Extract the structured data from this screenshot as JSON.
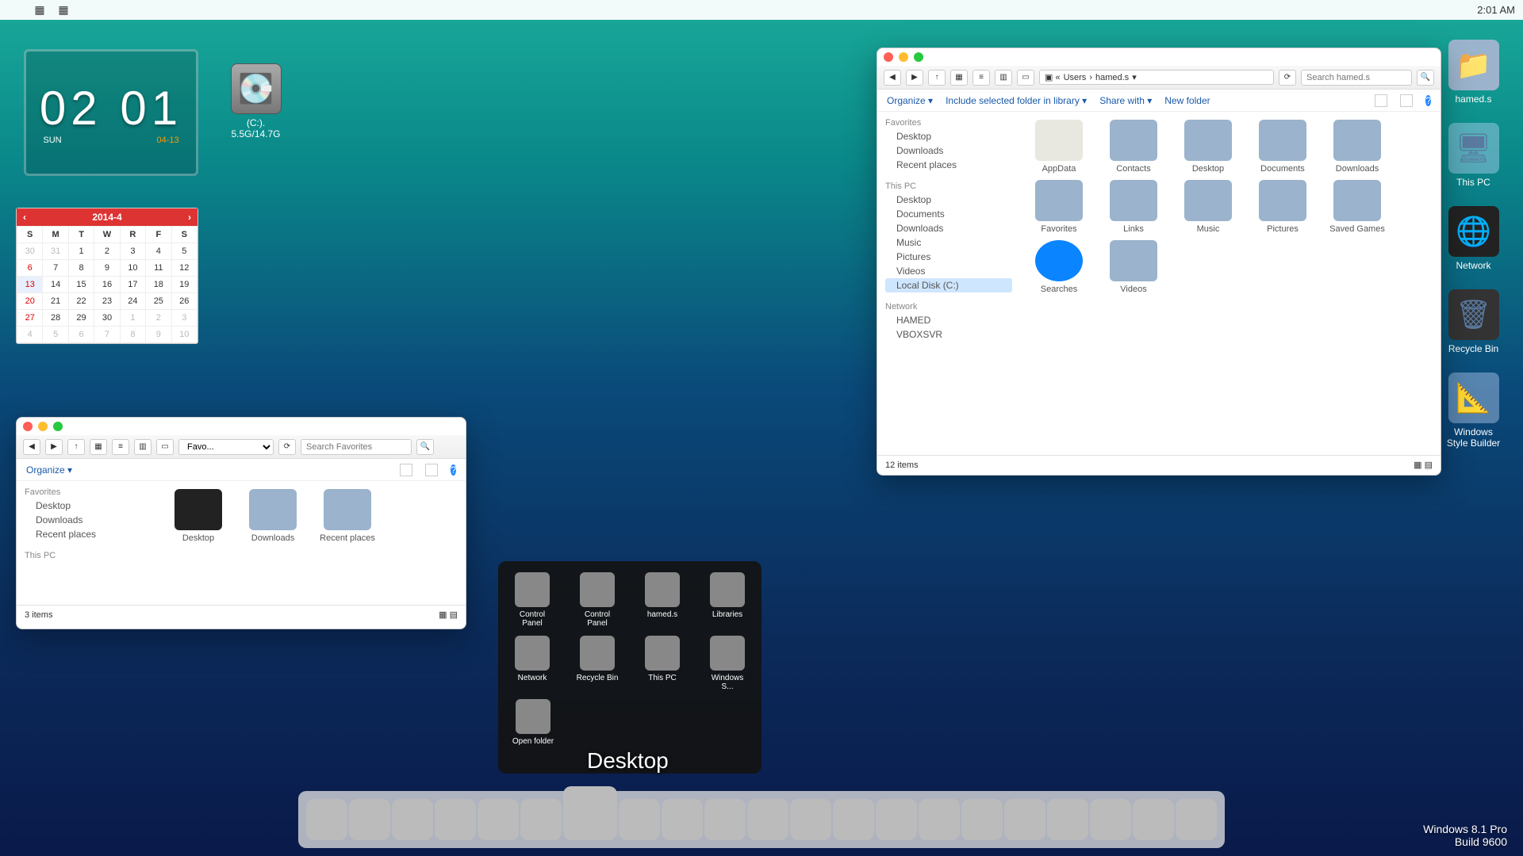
{
  "menubar": {
    "clock": "2:01 AM"
  },
  "brand": {
    "line1": "Windows 8.1 Pro",
    "line2": "Build 9600"
  },
  "desk": {
    "hameds": "hamed.s",
    "thispc": "This PC",
    "network": "Network",
    "recycle": "Recycle Bin",
    "style": "Windows\nStyle Builder",
    "drive": "(C:). 5.5G/14.7G"
  },
  "widgets": {
    "clock": {
      "time": "02 01",
      "day": "SUN",
      "date": "04-13"
    },
    "cal": {
      "title": "2014-4",
      "dow": [
        "S",
        "M",
        "T",
        "W",
        "R",
        "F",
        "S"
      ],
      "rows": [
        [
          "30",
          "31",
          "1",
          "2",
          "3",
          "4",
          "5"
        ],
        [
          "6",
          "7",
          "8",
          "9",
          "10",
          "11",
          "12"
        ],
        [
          "13",
          "14",
          "15",
          "16",
          "17",
          "18",
          "19"
        ],
        [
          "20",
          "21",
          "22",
          "23",
          "24",
          "25",
          "26"
        ],
        [
          "27",
          "28",
          "29",
          "30",
          "1",
          "2",
          "3"
        ],
        [
          "4",
          "5",
          "6",
          "7",
          "8",
          "9",
          "10"
        ]
      ],
      "gray": {
        "0": [
          0,
          1
        ],
        "4": [
          4,
          5,
          6
        ],
        "5": [
          0,
          1,
          2,
          3,
          4,
          5,
          6
        ]
      },
      "red": {
        "1": [
          0
        ],
        "2": [
          0
        ],
        "3": [
          0
        ],
        "4": [
          0
        ]
      },
      "today": [
        2,
        0
      ]
    }
  },
  "win2": {
    "crumb": [
      "Users",
      "hamed.s"
    ],
    "search_ph": "Search hamed.s",
    "ribbon": [
      "Organize ▾",
      "Include selected folder in library ▾",
      "Share with ▾",
      "New folder"
    ],
    "side": {
      "Favorites": [
        "Desktop",
        "Downloads",
        "Recent places"
      ],
      "This PC": [
        "Desktop",
        "Documents",
        "Downloads",
        "Music",
        "Pictures",
        "Videos",
        "Local Disk (C:)"
      ],
      "Network": [
        "HAMED",
        "VBOXSVR"
      ]
    },
    "items": [
      "AppData",
      "Contacts",
      "Desktop",
      "Documents",
      "Downloads",
      "Favorites",
      "Links",
      "Music",
      "Pictures",
      "Saved Games",
      "Searches",
      "Videos"
    ],
    "status": "12 items"
  },
  "win1": {
    "select": "Favo...",
    "search_ph": "Search Favorites",
    "ribbon": [
      "Organize ▾"
    ],
    "side": {
      "Favorites": [
        "Desktop",
        "Downloads",
        "Recent places"
      ],
      "This PC": []
    },
    "items": [
      "Desktop",
      "Downloads",
      "Recent places"
    ],
    "status": "3 items"
  },
  "stack": {
    "label": "Desktop",
    "items": [
      "Control Panel",
      "Control Panel",
      "hamed.s",
      "Libraries",
      "Network",
      "Recycle Bin",
      "This PC",
      "Windows S...",
      "Open folder"
    ]
  },
  "dock": {
    "tip": "Desktop",
    "count": 21
  }
}
